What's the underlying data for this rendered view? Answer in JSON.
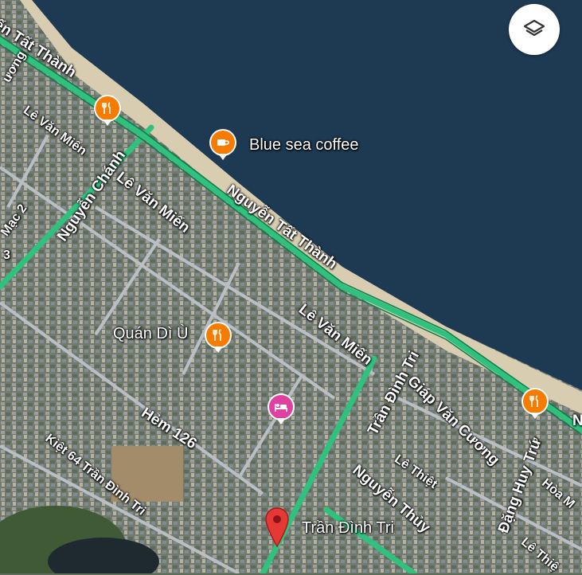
{
  "map": {
    "colors": {
      "sea": "#1e3a52",
      "beach": "#d8cdb0",
      "land": "#6b7663",
      "road": "#2ec27e"
    },
    "streets": [
      {
        "id": "nguyen-tat-thanh-top",
        "text": "ến Tất Thành"
      },
      {
        "id": "nguyen-tat-thanh",
        "text": "Nguyễn Tất Thành"
      },
      {
        "id": "le-van-mien-1",
        "text": "Lê Văn Miến"
      },
      {
        "id": "le-van-mien-2",
        "text": "Lê Văn Miến"
      },
      {
        "id": "le-van-mien-3",
        "text": "Lê Văn Miến"
      },
      {
        "id": "nguyen-chanh",
        "text": "Nguyễn Chánh"
      },
      {
        "id": "tran-dinh-tri-road",
        "text": "Trần Đình Tri"
      },
      {
        "id": "giap-van-cuong",
        "text": "Giáp Văn Cương"
      },
      {
        "id": "hem-126",
        "text": "Hẻm 126"
      },
      {
        "id": "kiet-64",
        "text": "Kiệt 64 Trần Đình Tri"
      },
      {
        "id": "le-thiet",
        "text": "Lê Thiệt"
      },
      {
        "id": "nguyen-thuy",
        "text": "Nguyễn Thủy"
      },
      {
        "id": "dang-huy-tru",
        "text": "Đặng Huy Trứ"
      },
      {
        "id": "hoa-m",
        "text": "Hòa M"
      },
      {
        "id": "le-thie",
        "text": "Lê Thiệ"
      },
      {
        "id": "mac-2",
        "text": "Mạc 2"
      },
      {
        "id": "uong",
        "text": "ương"
      },
      {
        "id": "s3",
        "text": "3"
      },
      {
        "id": "n-edge",
        "text": "N"
      }
    ],
    "pois": [
      {
        "id": "blue-sea-coffee",
        "label": "Blue sea coffee",
        "icon": "coffee-icon",
        "color": "#f57c00"
      },
      {
        "id": "quan-di-u",
        "label": "Quán Dì Ù",
        "icon": "restaurant-icon",
        "color": "#f57c00"
      },
      {
        "id": "restaurant-top",
        "label": "",
        "icon": "restaurant-icon",
        "color": "#f57c00"
      },
      {
        "id": "restaurant-right",
        "label": "",
        "icon": "restaurant-icon",
        "color": "#f57c00"
      },
      {
        "id": "hotel",
        "label": "",
        "icon": "bed-icon",
        "color": "#e040a0"
      }
    ],
    "pin": {
      "label": "Trần Đình Tri",
      "color": "#e53935"
    },
    "layers_button": {
      "icon": "layers-icon"
    }
  }
}
